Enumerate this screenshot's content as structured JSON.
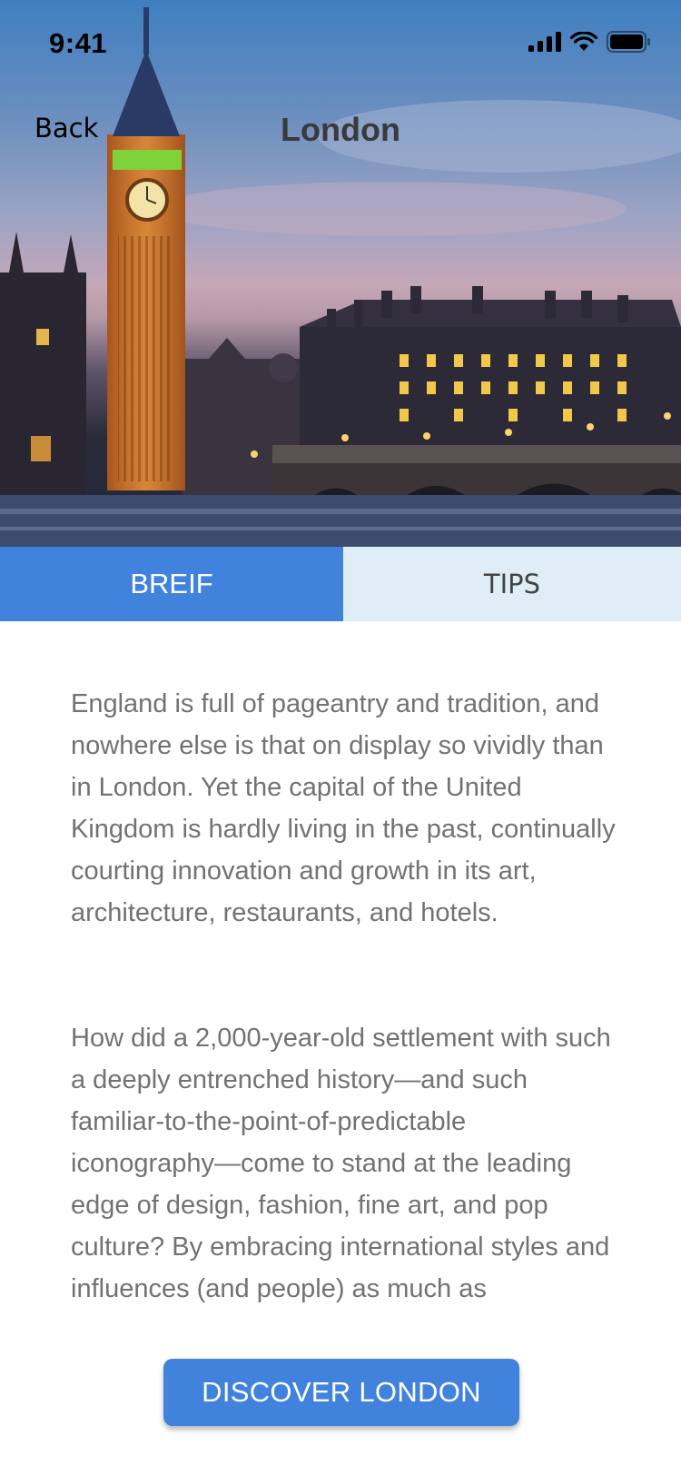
{
  "status_bar": {
    "time": "9:41"
  },
  "nav": {
    "back_label": "Back",
    "title": "London"
  },
  "hero": {
    "image": "big-ben-westminster-photo"
  },
  "tabs": [
    {
      "label": "BREIF",
      "selected": true
    },
    {
      "label": "TIPS",
      "selected": false
    }
  ],
  "content": {
    "paragraphs": [
      "England is full of pageantry and tradition, and nowhere else is that on display so vividly than in London. Yet the capital of the United Kingdom is hardly living in the past, continually courting innovation and growth in its art, architecture, restaurants, and hotels.",
      "How did a 2,000-year-old settlement with such a deeply entrenched history—and such familiar-to-the-point-of-predictable iconography—come to stand at the leading edge of design, fashion, fine art, and pop culture? By embracing international styles and influences (and people) as much as passionately as its"
    ]
  },
  "cta": {
    "label": "DISCOVER LONDON"
  },
  "colors": {
    "accent": "#4183dc",
    "tab_inactive": "#dfeef6",
    "body_text": "#727272"
  }
}
